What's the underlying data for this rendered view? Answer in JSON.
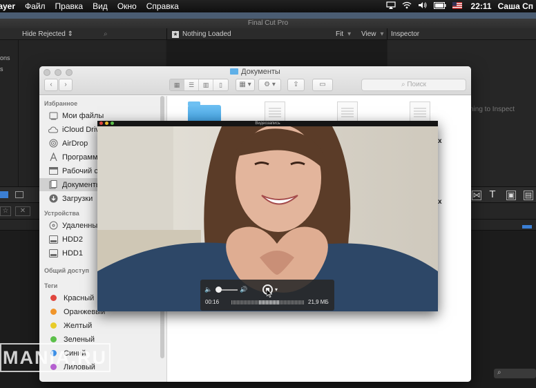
{
  "menubar": {
    "app_name": "layer",
    "items": [
      "Файл",
      "Правка",
      "Вид",
      "Окно",
      "Справка"
    ],
    "clock": "22:11",
    "user": "Саша Сп"
  },
  "fcp": {
    "window_title": "Final Cut Pro",
    "browser_filter": "Hide Rejected ⇕",
    "viewer_title": "Nothing Loaded",
    "fit_label": "Fit",
    "view_label": "View",
    "inspector_label": "Inspector",
    "inspector_hint": "ning to Inspect",
    "left_text_1": "ons",
    "left_text_2": "s"
  },
  "finder": {
    "title": "Документы",
    "search_placeholder": "Поиск",
    "favorites_header": "Избранное",
    "favorites": [
      {
        "label": "Мои файлы",
        "icon": "all-files-icon"
      },
      {
        "label": "iCloud Drive",
        "icon": "cloud-icon"
      },
      {
        "label": "AirDrop",
        "icon": "airdrop-icon"
      },
      {
        "label": "Программы",
        "icon": "applications-icon"
      },
      {
        "label": "Рабочий стол",
        "icon": "desktop-icon"
      },
      {
        "label": "Документы",
        "icon": "documents-icon"
      },
      {
        "label": "Загрузки",
        "icon": "downloads-icon"
      }
    ],
    "devices_header": "Устройства",
    "devices": [
      {
        "label": "Удаленный диск",
        "icon": "remote-disc-icon"
      },
      {
        "label": "HDD2",
        "icon": "drive-icon"
      },
      {
        "label": "HDD1",
        "icon": "drive-icon"
      }
    ],
    "shared_header": "Общий доступ",
    "tags_header": "Теги",
    "tags": [
      {
        "label": "Красный",
        "color": "#e0463e"
      },
      {
        "label": "Оранжевый",
        "color": "#f0952a"
      },
      {
        "label": "Желтый",
        "color": "#e8cc2a"
      },
      {
        "label": "Зеленый",
        "color": "#5cc04a"
      },
      {
        "label": "Синий",
        "color": "#3a8ee6"
      },
      {
        "label": "Лиловый",
        "color": "#b560d0"
      }
    ],
    "content_text_1": "x",
    "content_text_2": "x"
  },
  "video": {
    "window_title": "Видеозапись",
    "elapsed": "00:16",
    "file_size": "21,9 МБ"
  },
  "watermark": "MANIA.RU"
}
